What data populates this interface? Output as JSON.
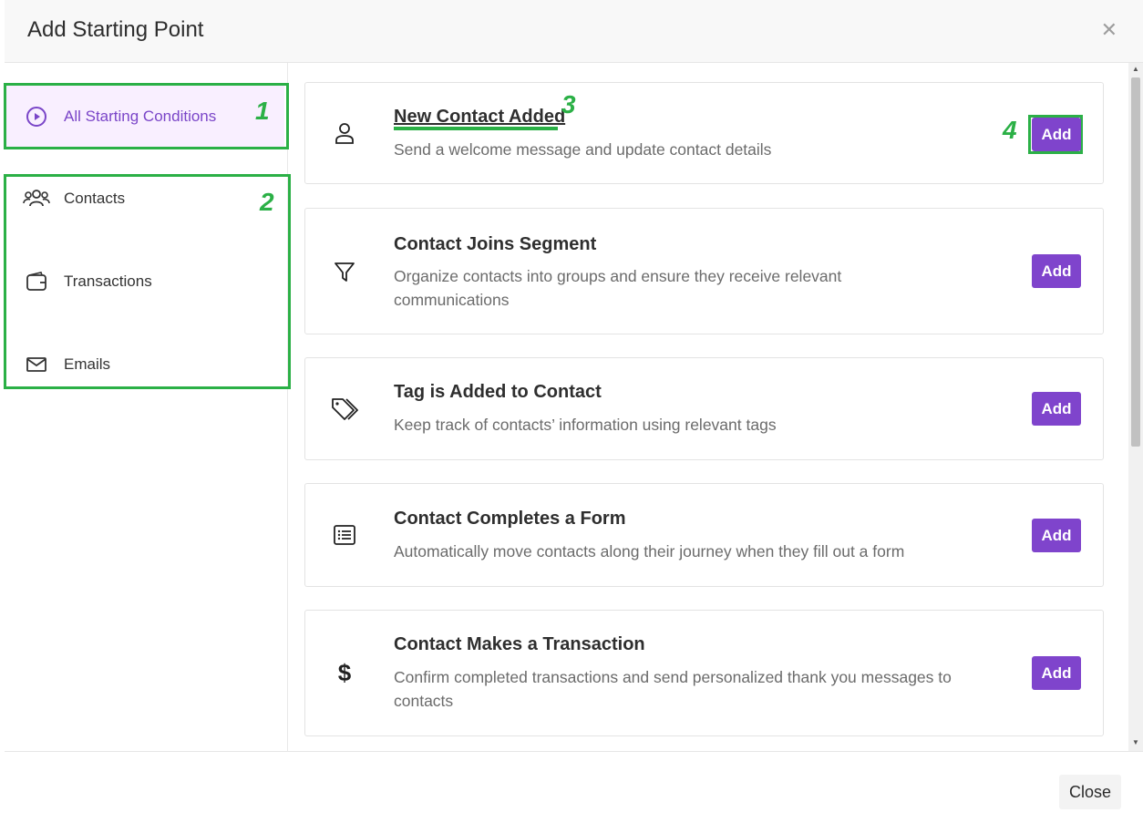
{
  "dialog": {
    "title": "Add Starting Point",
    "close_icon": "close-icon"
  },
  "sidebar": {
    "items": [
      {
        "label": "All Starting Conditions",
        "icon": "play-circle-icon",
        "active": true
      },
      {
        "label": "Contacts",
        "icon": "users-icon",
        "active": false
      },
      {
        "label": "Transactions",
        "icon": "wallet-icon",
        "active": false
      },
      {
        "label": "Emails",
        "icon": "envelope-icon",
        "active": false
      }
    ]
  },
  "annotations": [
    "1",
    "2",
    "3",
    "4"
  ],
  "cards": [
    {
      "icon": "user-icon",
      "title": "New Contact Added",
      "description": "Send a welcome message and update contact details",
      "button": "Add"
    },
    {
      "icon": "filter-icon",
      "title": "Contact Joins Segment",
      "description": "Organize contacts into groups and ensure they receive relevant communications",
      "button": "Add"
    },
    {
      "icon": "tags-icon",
      "title": "Tag is Added to Contact",
      "description": "Keep track of contacts’ information using relevant tags",
      "button": "Add"
    },
    {
      "icon": "list-form-icon",
      "title": "Contact Completes a Form",
      "description": "Automatically move contacts along their journey when they fill out a form",
      "button": "Add"
    },
    {
      "icon": "dollar-icon",
      "title": "Contact Makes a Transaction",
      "description": "Confirm completed transactions and send personalized thank you messages to contacts",
      "button": "Add"
    }
  ],
  "footer": {
    "close_label": "Close"
  },
  "colors": {
    "accent": "#7f44cc",
    "active_bg": "#f9efff",
    "annotation": "#2bb046"
  }
}
